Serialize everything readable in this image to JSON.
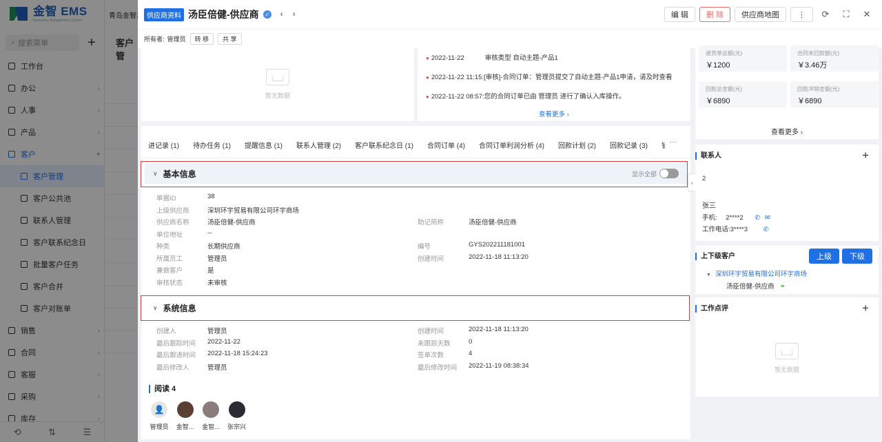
{
  "bg": {
    "logo_text": "金智 EMS",
    "logo_sub": "Enterprise Management System",
    "company": "青岛金智测",
    "search_placeholder": "搜索菜单",
    "content_title": "客户管",
    "menu": [
      {
        "label": "工作台"
      },
      {
        "label": "办公"
      },
      {
        "label": "人事"
      },
      {
        "label": "产品"
      },
      {
        "label": "客户"
      },
      {
        "label": "客户管理"
      },
      {
        "label": "客户公共池"
      },
      {
        "label": "联系人管理"
      },
      {
        "label": "客户联系纪念日"
      },
      {
        "label": "批量客户任务"
      },
      {
        "label": "客户合并"
      },
      {
        "label": "客户对账单"
      },
      {
        "label": "销售"
      },
      {
        "label": "合同"
      },
      {
        "label": "客服"
      },
      {
        "label": "采购"
      },
      {
        "label": "库存"
      }
    ]
  },
  "header": {
    "tag": "供应商资料",
    "title": "汤臣倍健-供应商",
    "edit": "编 辑",
    "delete": "删 除",
    "map": "供应商地图"
  },
  "owner": {
    "label": "所有者:",
    "name": "管理员",
    "transfer": "转 移",
    "share": "共 享"
  },
  "empty_text": "暂无数据",
  "dynamics": [
    {
      "time": "2022-11-22",
      "text": "审核类型 自动主题-产品1"
    },
    {
      "time": "2022-11-22 11:15:",
      "text": "[审核]-合同订单：管理员提交了自动主题-产品1申请，请及时查看"
    },
    {
      "time": "2022-11-22 08:57:",
      "text": "您的合同订单已由 管理员 进行了确认入库操作。"
    }
  ],
  "view_more": "查看更多",
  "tabs": [
    "进记录 (1)",
    "待办任务 (1)",
    "提醒信息 (1)",
    "联系人管理 (2)",
    "客户联系纪念日 (1)",
    "合同订单 (4)",
    "合同订单利润分析 (4)",
    "回款计划 (2)",
    "回款记录 (3)",
    "销售退"
  ],
  "tab_more": "···",
  "basic": {
    "title": "基本信息",
    "toggle_label": "显示全部",
    "left": [
      {
        "label": "单据ID",
        "value": "38"
      },
      {
        "label": "上级供应商",
        "value": "深圳环宇贸易有限公司环宇商场"
      },
      {
        "label": "供应商名称",
        "value": "汤臣倍健-供应商"
      },
      {
        "label": "单位地址",
        "value": "--"
      },
      {
        "label": "种类",
        "value": "长期供应商"
      },
      {
        "label": "所属员工",
        "value": "管理员"
      },
      {
        "label": "兼做客户",
        "value": "是"
      },
      {
        "label": "审核状态",
        "value": "未审核"
      }
    ],
    "right": [
      {
        "label": "助记简称",
        "value": "汤臣倍健-供应商"
      },
      {
        "label": "编号",
        "value": "GYS202211181001"
      },
      {
        "label": "创建时间",
        "value": "2022-11-18 11:13:20"
      }
    ]
  },
  "system": {
    "title": "系统信息",
    "left": [
      {
        "label": "创建人",
        "value": "管理员"
      },
      {
        "label": "最后跟踪时间",
        "value": "2022-11-22"
      },
      {
        "label": "最后跟进时间",
        "value": "2022-11-18 15:24:23"
      },
      {
        "label": "最后修改人",
        "value": "管理员"
      }
    ],
    "right": [
      {
        "label": "创建时间",
        "value": "2022-11-18 11:13:20"
      },
      {
        "label": "未跟踪天数",
        "value": "0"
      },
      {
        "label": "签单次数",
        "value": "4"
      },
      {
        "label": "最后修改时间",
        "value": "2022-11-19 08:38:34"
      }
    ]
  },
  "read": {
    "title": "阅读 4",
    "readers": [
      {
        "name": "管理员",
        "color": "#e6e6e6"
      },
      {
        "name": "金智...",
        "color": "#5a4032"
      },
      {
        "name": "金智...",
        "color": "#8a7c7c"
      },
      {
        "name": "张宗兴",
        "color": "#2b2b33"
      }
    ]
  },
  "stats": [
    {
      "label": "退货单总额(元)",
      "value": "￥1200"
    },
    {
      "label": "合同未回款额(元)",
      "value": "￥3.46万"
    },
    {
      "label": "回款总金额(元)",
      "value": "￥6890"
    },
    {
      "label": "回款冲销金额(元)",
      "value": "￥6890"
    }
  ],
  "contacts": {
    "title": "联系人",
    "count": "2",
    "name": "张三",
    "phone_label": "手机:",
    "phone": "2****2",
    "work_label": "工作电话:",
    "work": "3****3"
  },
  "hierarchy": {
    "title": "上下级客户",
    "up": "上级",
    "down": "下级",
    "parent": "深圳环宇贸易有限公司环宇商场",
    "child": "汤臣倍健-供应商"
  },
  "review": {
    "title": "工作点评"
  },
  "colors": {
    "primary": "#1f6fe5",
    "danger": "#f56c6c",
    "highlight": "#d93a3a"
  }
}
